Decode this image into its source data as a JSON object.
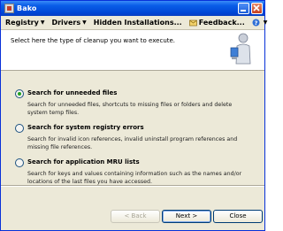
{
  "window": {
    "title": "Bako"
  },
  "menubar": {
    "items": [
      {
        "label": "Registry"
      },
      {
        "label": "Drivers"
      },
      {
        "label": "Hidden Installations..."
      },
      {
        "label": "Feedback..."
      }
    ],
    "help_icon": "help-icon"
  },
  "header": {
    "instruction": "Select here the type of cleanup you want to execute."
  },
  "options": [
    {
      "title": "Search for unneeded files",
      "description": "Search for unneeded files, shortcuts to missing files or folders and delete system temp files.",
      "checked": true
    },
    {
      "title": "Search for system registry errors",
      "description": "Search for invalid icon references, invalid uninstall program references and missing file references.",
      "checked": false
    },
    {
      "title": "Search for application MRU lists",
      "description": "Search for keys and values containing information such as the names and/or locations of the last files you have accessed.",
      "checked": false
    }
  ],
  "buttons": {
    "back": "< Back",
    "next": "Next >",
    "close": "Close"
  },
  "colors": {
    "titlebar": "#0a5ee8",
    "accent_radio": "#21a121"
  }
}
